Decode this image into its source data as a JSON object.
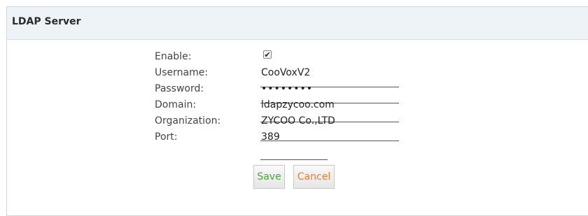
{
  "panel": {
    "title": "LDAP Server"
  },
  "form": {
    "enable": {
      "label": "Enable:",
      "checked": true,
      "check_glyph": "✔"
    },
    "username": {
      "label": "Username:",
      "value": "CooVoxV2"
    },
    "password": {
      "label": "Password:",
      "value": "••••••••"
    },
    "domain": {
      "label": "Domain:",
      "value": "ldapzycoo.com"
    },
    "organization": {
      "label": "Organization:",
      "value": "ZYCOO Co.,LTD"
    },
    "port": {
      "label": "Port:",
      "value": "389"
    }
  },
  "buttons": {
    "save_label": "Save",
    "cancel_label": "Cancel",
    "save_color": "#47a43a",
    "cancel_color": "#ee7d2b"
  }
}
